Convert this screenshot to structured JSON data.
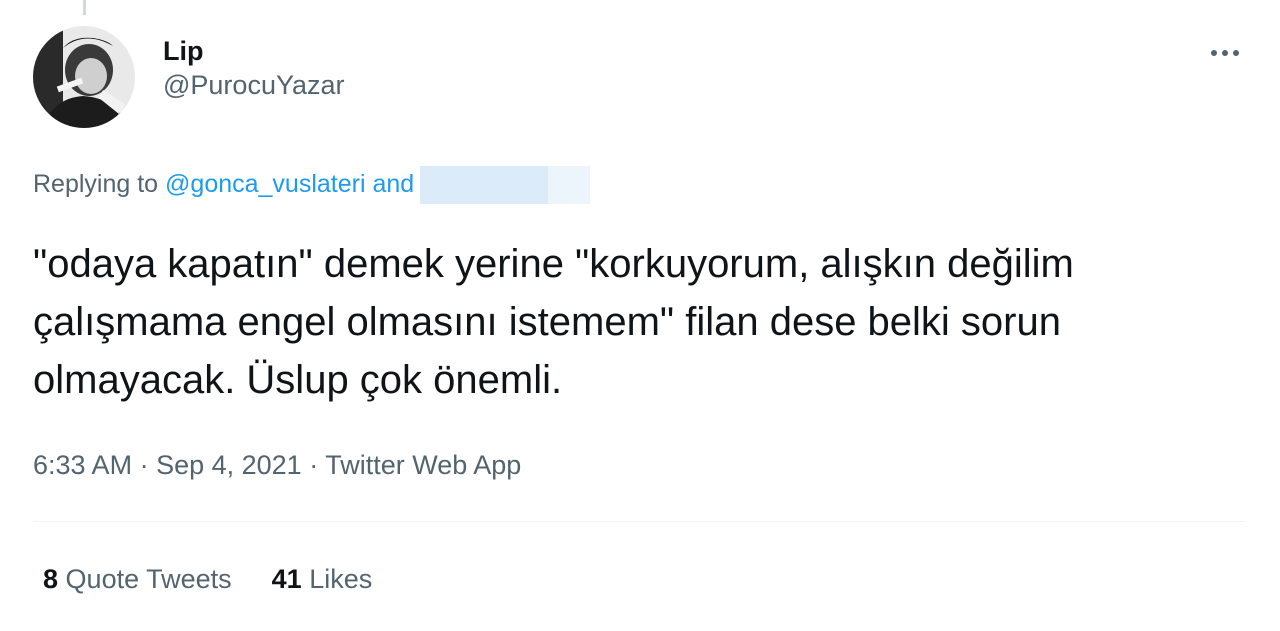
{
  "tweet": {
    "author": {
      "display_name": "Lip",
      "handle": "@PurocuYazar"
    },
    "reply": {
      "prefix": "Replying to ",
      "mentions": "@gonca_vuslateri and"
    },
    "text": "\"odaya kapatın\" demek yerine \"korkuyorum, alışkın değilim çalışmama engel olmasını istemem\" filan dese belki sorun olmayacak. Üslup çok önemli.",
    "time": "6:33 AM",
    "separator": " · ",
    "date": "Sep 4, 2021",
    "source": "Twitter Web App",
    "stats": {
      "quote_count": "8",
      "quote_label": "Quote Tweets",
      "like_count": "41",
      "like_label": "Likes"
    },
    "more_icon": "more-horizontal-icon"
  },
  "colors": {
    "primary_text": "#0f1419",
    "secondary_text": "#536471",
    "link": "#1d9bf0",
    "divider": "#eff3f4"
  }
}
